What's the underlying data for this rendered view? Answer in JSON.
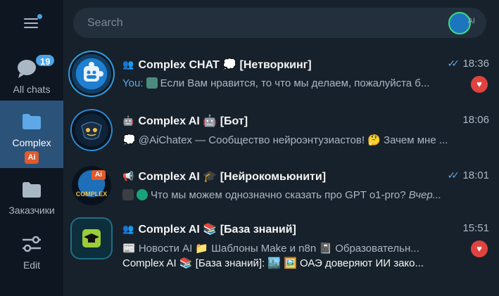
{
  "sidebar": {
    "folders": [
      {
        "label": "All chats",
        "unread": "19"
      },
      {
        "label": "Complex",
        "sub": "Ai"
      },
      {
        "label": "Заказчики"
      },
      {
        "label": "Edit"
      }
    ]
  },
  "search": {
    "placeholder": "Search",
    "avatar_text": "AI"
  },
  "chats": [
    {
      "title": "Complex CHAT 💭 [Нетворкинг]",
      "time": "18:36",
      "sender": "You:",
      "preview": "Если Вам нравится, то что мы делаем, пожалуйста б...",
      "reaction": "♥"
    },
    {
      "title": "Complex AI 🤖 [Бот]",
      "time": "18:06",
      "preview": "💭 @AiChatex — Сообщество нейроэнтузиастов! 🤔 Зачем мне ..."
    },
    {
      "title": "Complex AI 🎓 [Нейрокомьюнити]",
      "time": "18:01",
      "preview": "Что мы можем однозначно сказать про GPT o1-pro?",
      "preview_italic": "Вчер...",
      "avatar_text": "COMPLEX",
      "avatar_ai": "Ai"
    },
    {
      "title": "Complex AI 📚 [База знаний]",
      "time": "15:51",
      "preview": "📰 Новости AI  📁 Шаблоны Make и n8n  📓 Образовательн...",
      "preview2": "Complex AI 📚 [База знаний]: 🏙️ 🖼️ ОАЭ доверяют ИИ зако...",
      "reaction": "♥"
    }
  ]
}
